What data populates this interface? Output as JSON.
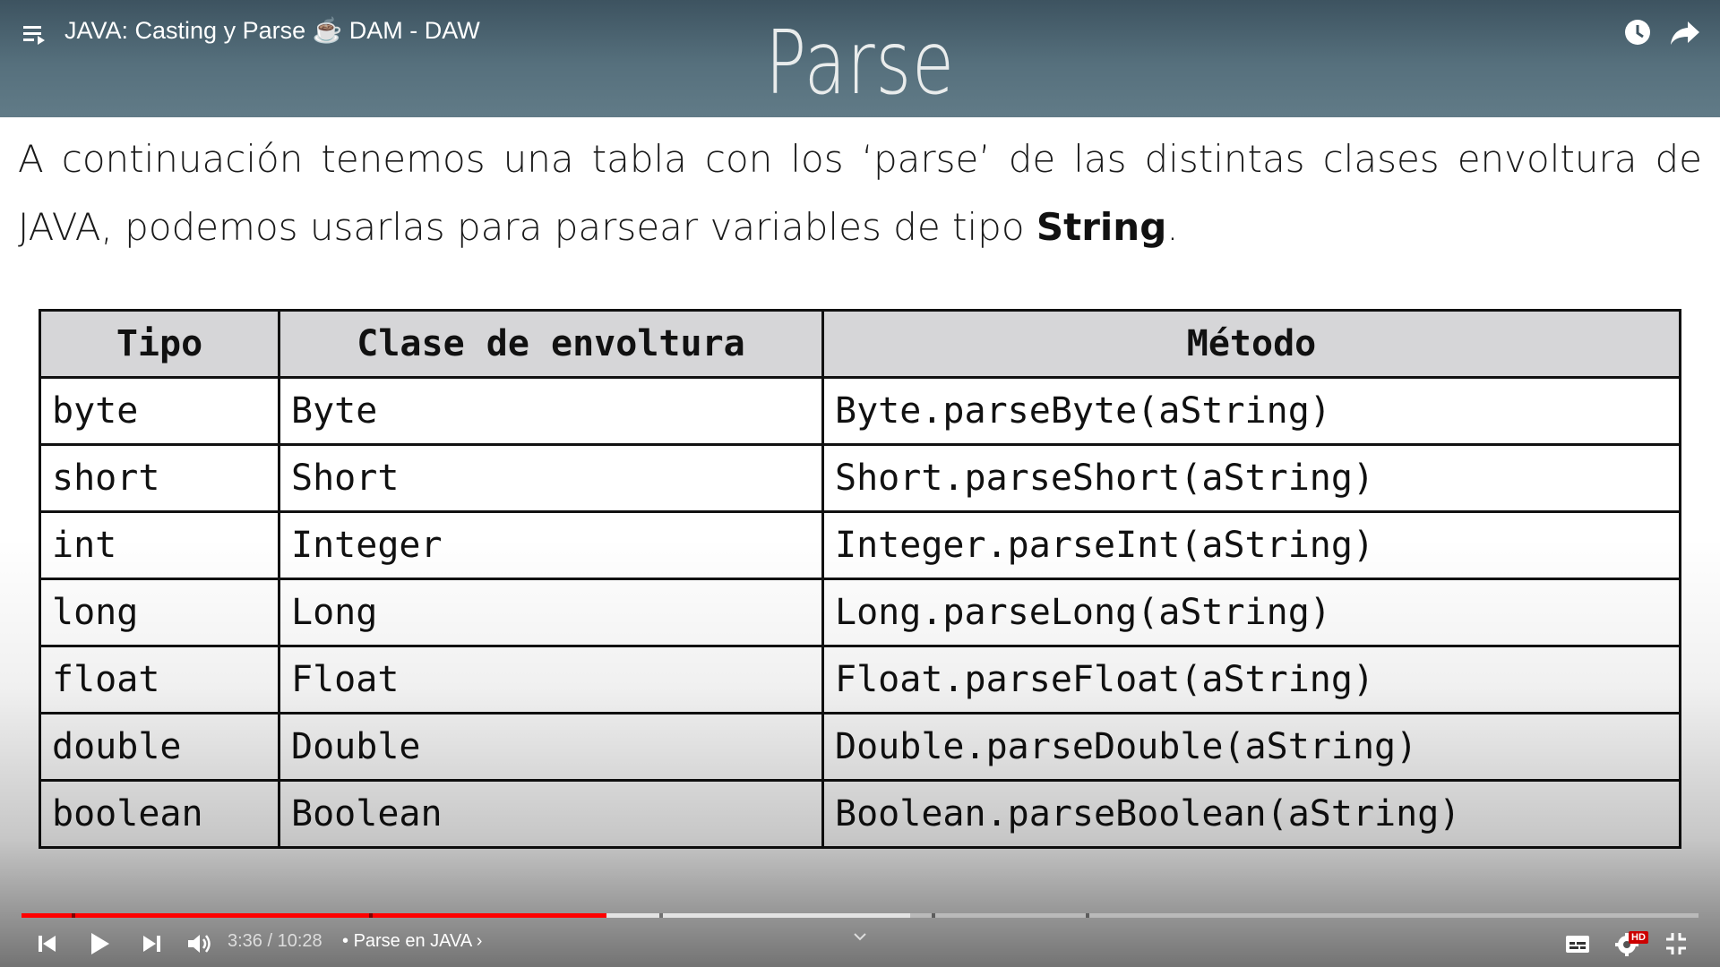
{
  "video": {
    "title": "JAVA: Casting y Parse ☕ DAM - DAW",
    "time_current": "3:36",
    "time_separator": " / ",
    "time_total": "10:28",
    "chapter_separator": " • ",
    "chapter": "Parse en JAVA",
    "chapter_chevron": "›",
    "progress_played": 0.349,
    "progress_loaded": 0.53,
    "hd_label": "HD"
  },
  "slide": {
    "title": "Parse",
    "intro_line1": "A continuación tenemos una tabla con los ‘parse’ de las distintas clases envoltura de",
    "intro_line2_pre": "JAVA, podemos usarlas para parsear variables de tipo ",
    "intro_line2_bold": "String",
    "intro_line2_post": "."
  },
  "table": {
    "headers": [
      "Tipo",
      "Clase de envoltura",
      "Método"
    ],
    "rows": [
      [
        "byte",
        "Byte",
        "Byte.parseByte(aString)"
      ],
      [
        "short",
        "Short",
        "Short.parseShort(aString)"
      ],
      [
        "int",
        "Integer",
        "Integer.parseInt(aString)"
      ],
      [
        "long",
        "Long",
        "Long.parseLong(aString)"
      ],
      [
        "float",
        "Float",
        "Float.parseFloat(aString)"
      ],
      [
        "double",
        "Double",
        "Double.parseDouble(aString)"
      ],
      [
        "boolean",
        "Boolean",
        "Boolean.parseBoolean(aString)"
      ]
    ]
  },
  "colors": {
    "header_band": "#56707d",
    "table_header_bg": "#d6d6d8",
    "progress_red": "#ff0000"
  },
  "icons": [
    "playlist-icon",
    "clock-icon",
    "share-icon",
    "previous-icon",
    "play-icon",
    "next-icon",
    "volume-icon",
    "chevron-down-icon",
    "subtitles-icon",
    "settings-icon",
    "exit-fullscreen-icon"
  ]
}
